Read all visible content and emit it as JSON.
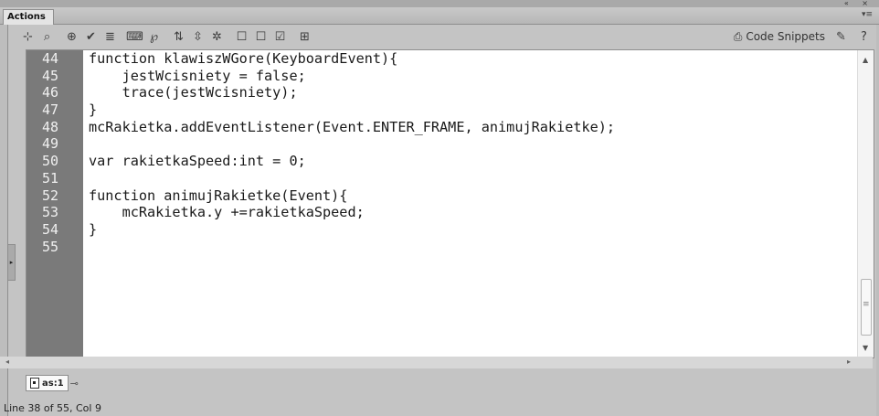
{
  "panel": {
    "title": "Actions",
    "window_controls": "«  ×",
    "menu_glyph": "▾≡"
  },
  "toolbar": {
    "icons": [
      "add-statement-icon",
      "find-icon",
      "insert-target-path-icon",
      "check-syntax-icon",
      "auto-format-icon",
      "show-code-hint-icon",
      "debug-options-icon",
      "collapse-between-braces-icon",
      "collapse-selection-icon",
      "expand-all-icon",
      "apply-block-comment-icon",
      "apply-line-comment-icon",
      "remove-comment-icon",
      "show-hide-toolbox-icon"
    ],
    "code_snippets_label": "Code Snippets"
  },
  "editor": {
    "line_numbers": [
      "44",
      "45",
      "46",
      "47",
      "48",
      "49",
      "50",
      "51",
      "52",
      "53",
      "54",
      "55"
    ],
    "lines": [
      "function klawiszWGore(KeyboardEvent){",
      "    jestWcisniety = false;",
      "    trace(jestWcisniety);",
      "}",
      "mcRakietka.addEventListener(Event.ENTER_FRAME, animujRakietke);",
      "",
      "var rakietkaSpeed:int = 0;",
      "",
      "function animujRakietke(Event){",
      "    mcRakietka.y +=rakietkaSpeed;",
      "}",
      ""
    ]
  },
  "file_tabs": [
    {
      "label": "as:1"
    }
  ],
  "status": {
    "text": "Line 38 of 55, Col 9"
  }
}
